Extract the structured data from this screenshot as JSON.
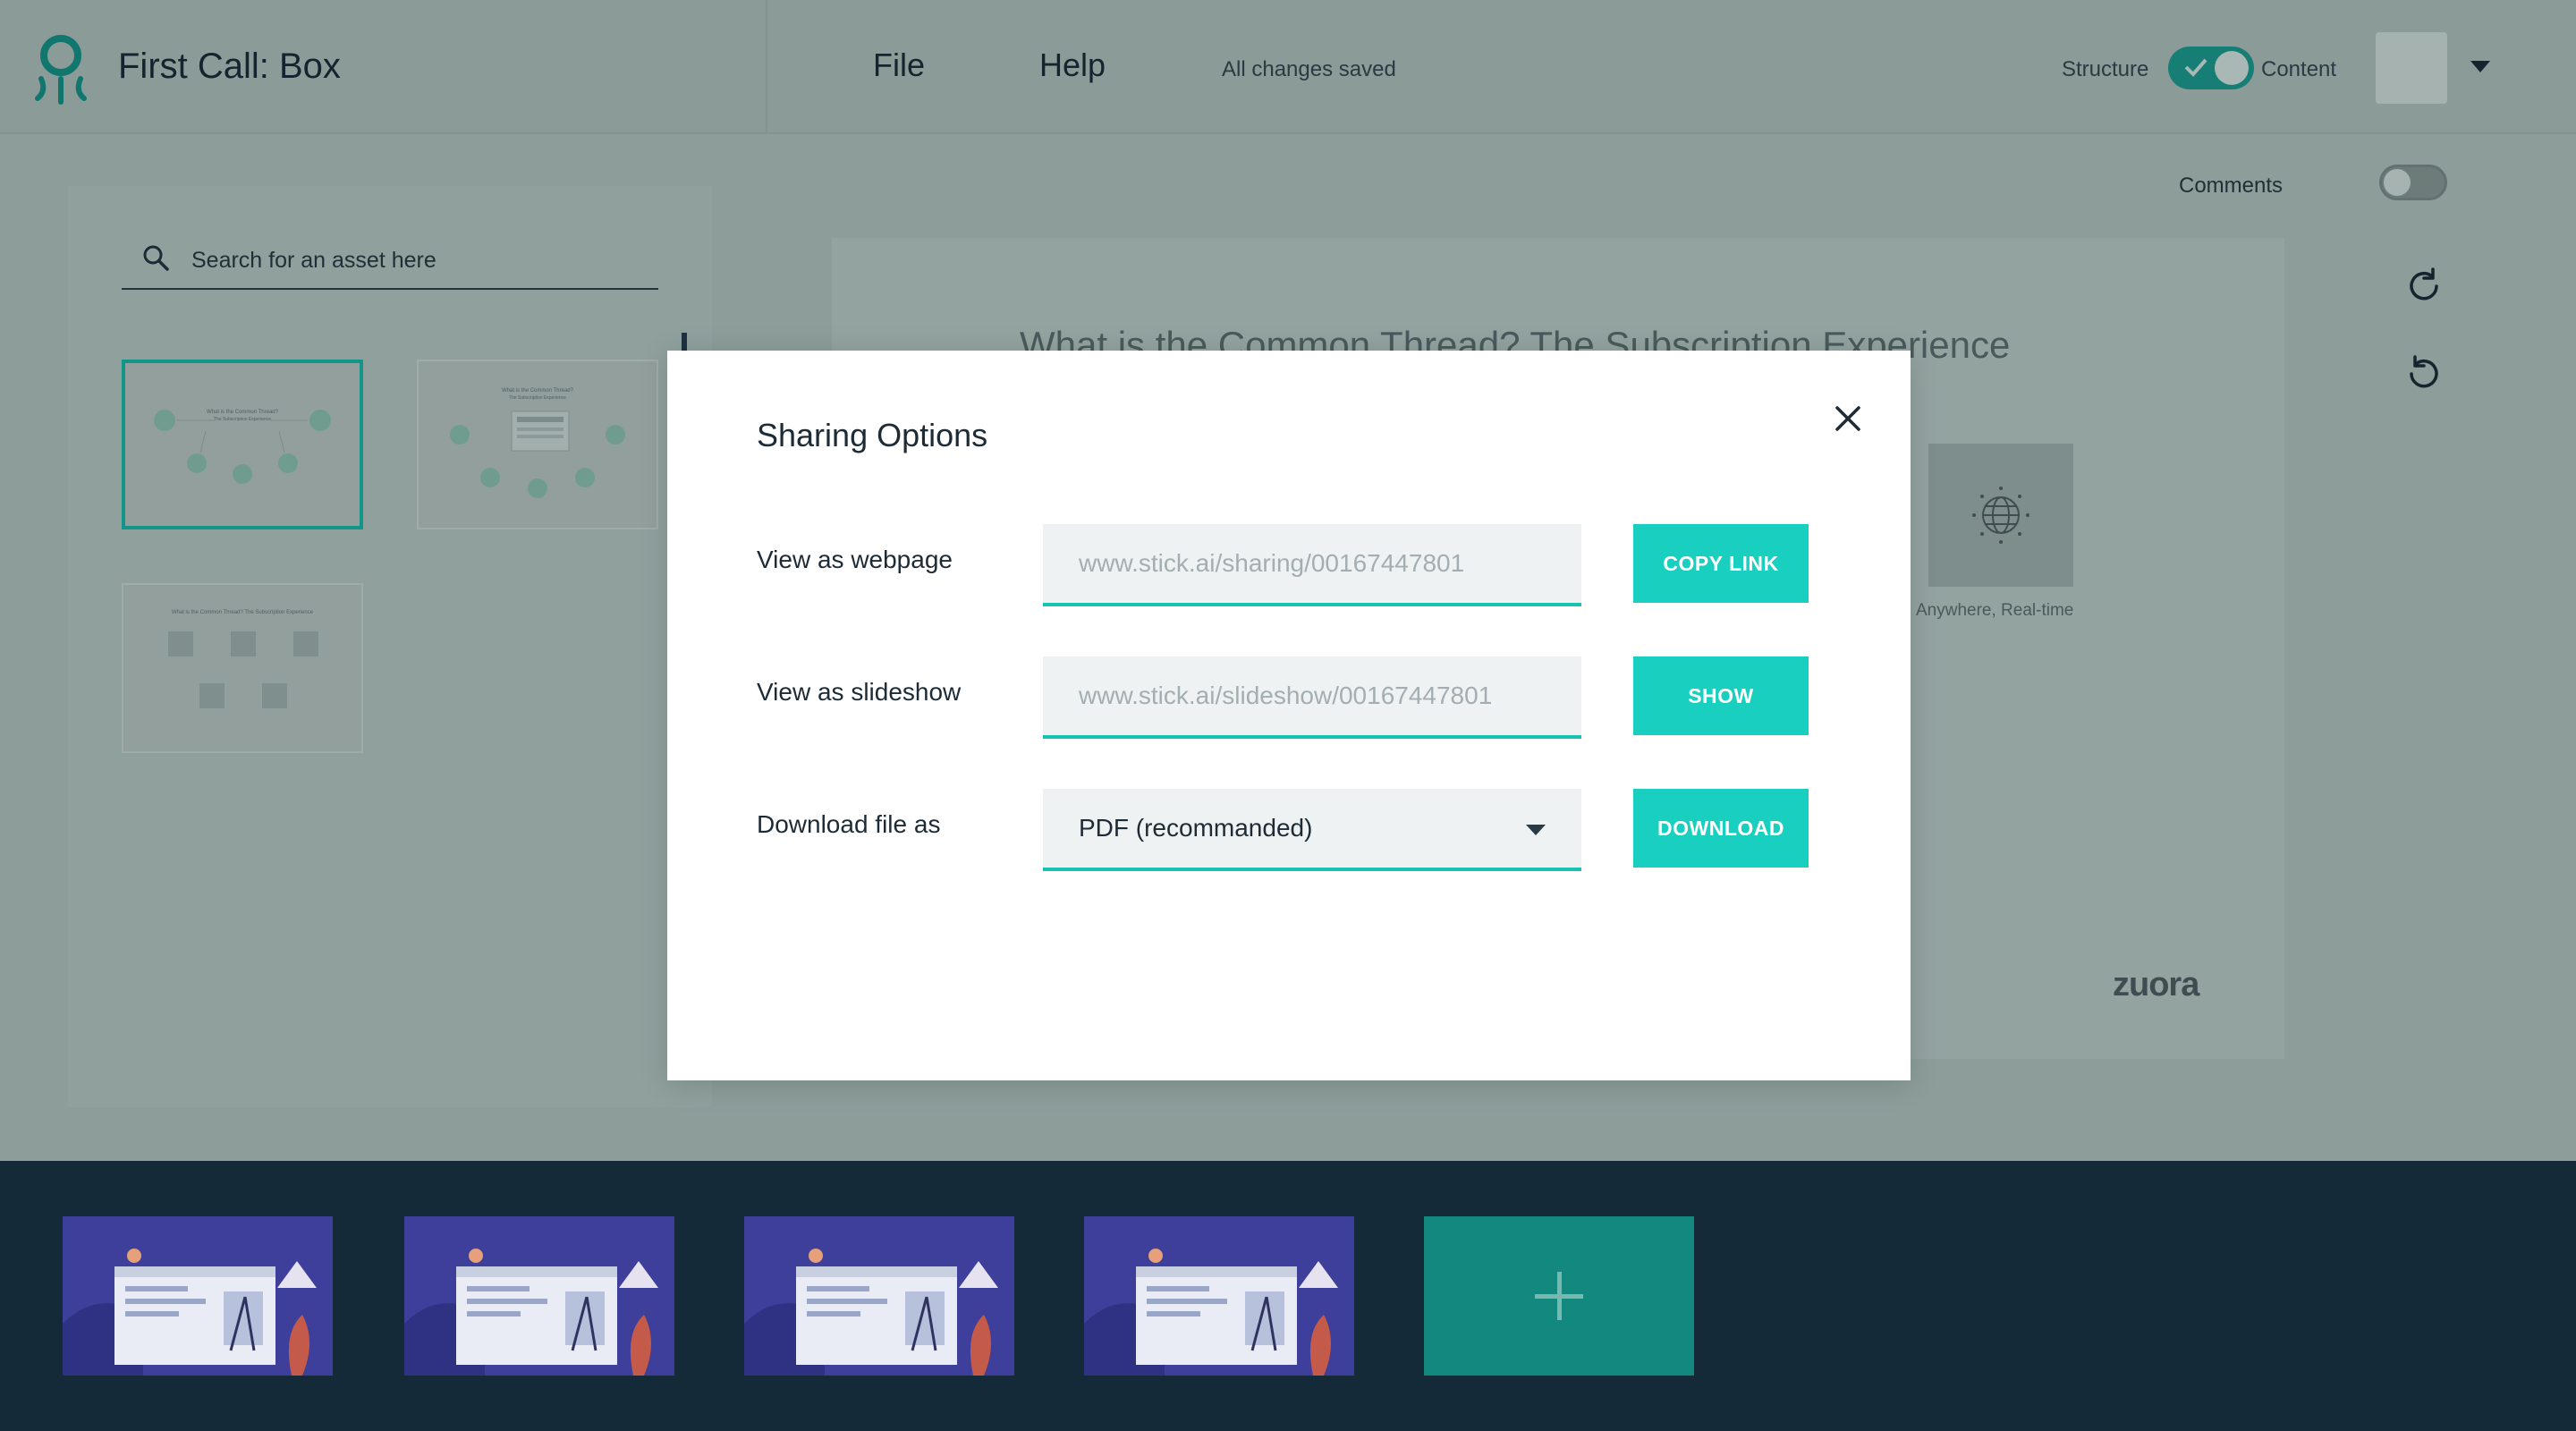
{
  "header": {
    "app_title": "First Call: Box",
    "menu": [
      "File",
      "Help"
    ],
    "save_status": "All changes saved",
    "mode_toggle": {
      "left_label": "Structure",
      "right_label": "Content",
      "state": "on"
    }
  },
  "left_panel": {
    "search": {
      "placeholder": "Search for an asset here",
      "value": ""
    },
    "thumbnails": [
      {
        "title": "What is the Common Thread?",
        "subtitle": "The Subscription Experience",
        "selected": true
      },
      {
        "title": "What is the Common Thread?",
        "subtitle": "The Subscription Experience",
        "selected": false
      },
      {
        "title": "What is the Common Thread? The Subscription Experience",
        "selected": false
      }
    ]
  },
  "canvas": {
    "slide_title": "What is the Common Thread? The Subscription Experience",
    "tile_label": "Anywhere, Real-time",
    "brand": "zuora",
    "comments_label": "Comments",
    "comments_enabled": false
  },
  "modal": {
    "title": "Sharing Options",
    "rows": [
      {
        "label": "View as webpage",
        "value": "www.stick.ai/sharing/00167447801",
        "button": "COPY LINK"
      },
      {
        "label": "View as slideshow",
        "value": "www.stick.ai/slideshow/00167447801",
        "button": "SHOW"
      },
      {
        "label": "Download file as",
        "value": "PDF (recommanded)",
        "button": "DOWNLOAD"
      }
    ]
  },
  "colors": {
    "accent": "#19d0c0",
    "overlay": "#8a9b98",
    "strip_bg": "#142a39",
    "add_slide": "#12887e"
  }
}
